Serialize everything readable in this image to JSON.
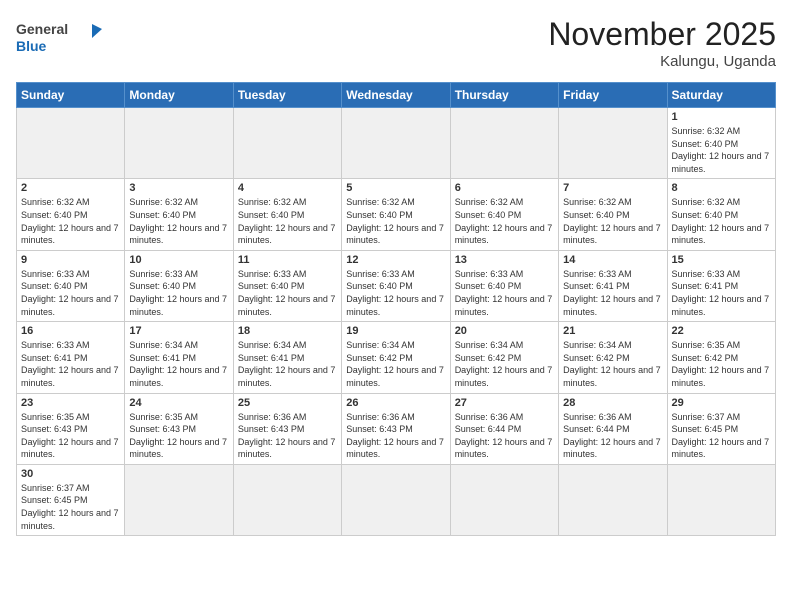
{
  "logo": {
    "text_general": "General",
    "text_blue": "Blue"
  },
  "title": {
    "month_year": "November 2025",
    "location": "Kalungu, Uganda"
  },
  "weekdays": [
    "Sunday",
    "Monday",
    "Tuesday",
    "Wednesday",
    "Thursday",
    "Friday",
    "Saturday"
  ],
  "weeks": [
    [
      {
        "day": "",
        "empty": true
      },
      {
        "day": "",
        "empty": true
      },
      {
        "day": "",
        "empty": true
      },
      {
        "day": "",
        "empty": true
      },
      {
        "day": "",
        "empty": true
      },
      {
        "day": "",
        "empty": true
      },
      {
        "day": "1",
        "sunrise": "6:32 AM",
        "sunset": "6:40 PM",
        "daylight": "12 hours and 7 minutes."
      }
    ],
    [
      {
        "day": "2",
        "sunrise": "6:32 AM",
        "sunset": "6:40 PM",
        "daylight": "12 hours and 7 minutes."
      },
      {
        "day": "3",
        "sunrise": "6:32 AM",
        "sunset": "6:40 PM",
        "daylight": "12 hours and 7 minutes."
      },
      {
        "day": "4",
        "sunrise": "6:32 AM",
        "sunset": "6:40 PM",
        "daylight": "12 hours and 7 minutes."
      },
      {
        "day": "5",
        "sunrise": "6:32 AM",
        "sunset": "6:40 PM",
        "daylight": "12 hours and 7 minutes."
      },
      {
        "day": "6",
        "sunrise": "6:32 AM",
        "sunset": "6:40 PM",
        "daylight": "12 hours and 7 minutes."
      },
      {
        "day": "7",
        "sunrise": "6:32 AM",
        "sunset": "6:40 PM",
        "daylight": "12 hours and 7 minutes."
      },
      {
        "day": "8",
        "sunrise": "6:32 AM",
        "sunset": "6:40 PM",
        "daylight": "12 hours and 7 minutes."
      }
    ],
    [
      {
        "day": "9",
        "sunrise": "6:33 AM",
        "sunset": "6:40 PM",
        "daylight": "12 hours and 7 minutes."
      },
      {
        "day": "10",
        "sunrise": "6:33 AM",
        "sunset": "6:40 PM",
        "daylight": "12 hours and 7 minutes."
      },
      {
        "day": "11",
        "sunrise": "6:33 AM",
        "sunset": "6:40 PM",
        "daylight": "12 hours and 7 minutes."
      },
      {
        "day": "12",
        "sunrise": "6:33 AM",
        "sunset": "6:40 PM",
        "daylight": "12 hours and 7 minutes."
      },
      {
        "day": "13",
        "sunrise": "6:33 AM",
        "sunset": "6:40 PM",
        "daylight": "12 hours and 7 minutes."
      },
      {
        "day": "14",
        "sunrise": "6:33 AM",
        "sunset": "6:41 PM",
        "daylight": "12 hours and 7 minutes."
      },
      {
        "day": "15",
        "sunrise": "6:33 AM",
        "sunset": "6:41 PM",
        "daylight": "12 hours and 7 minutes."
      }
    ],
    [
      {
        "day": "16",
        "sunrise": "6:33 AM",
        "sunset": "6:41 PM",
        "daylight": "12 hours and 7 minutes."
      },
      {
        "day": "17",
        "sunrise": "6:34 AM",
        "sunset": "6:41 PM",
        "daylight": "12 hours and 7 minutes."
      },
      {
        "day": "18",
        "sunrise": "6:34 AM",
        "sunset": "6:41 PM",
        "daylight": "12 hours and 7 minutes."
      },
      {
        "day": "19",
        "sunrise": "6:34 AM",
        "sunset": "6:42 PM",
        "daylight": "12 hours and 7 minutes."
      },
      {
        "day": "20",
        "sunrise": "6:34 AM",
        "sunset": "6:42 PM",
        "daylight": "12 hours and 7 minutes."
      },
      {
        "day": "21",
        "sunrise": "6:34 AM",
        "sunset": "6:42 PM",
        "daylight": "12 hours and 7 minutes."
      },
      {
        "day": "22",
        "sunrise": "6:35 AM",
        "sunset": "6:42 PM",
        "daylight": "12 hours and 7 minutes."
      }
    ],
    [
      {
        "day": "23",
        "sunrise": "6:35 AM",
        "sunset": "6:43 PM",
        "daylight": "12 hours and 7 minutes."
      },
      {
        "day": "24",
        "sunrise": "6:35 AM",
        "sunset": "6:43 PM",
        "daylight": "12 hours and 7 minutes."
      },
      {
        "day": "25",
        "sunrise": "6:36 AM",
        "sunset": "6:43 PM",
        "daylight": "12 hours and 7 minutes."
      },
      {
        "day": "26",
        "sunrise": "6:36 AM",
        "sunset": "6:43 PM",
        "daylight": "12 hours and 7 minutes."
      },
      {
        "day": "27",
        "sunrise": "6:36 AM",
        "sunset": "6:44 PM",
        "daylight": "12 hours and 7 minutes."
      },
      {
        "day": "28",
        "sunrise": "6:36 AM",
        "sunset": "6:44 PM",
        "daylight": "12 hours and 7 minutes."
      },
      {
        "day": "29",
        "sunrise": "6:37 AM",
        "sunset": "6:45 PM",
        "daylight": "12 hours and 7 minutes."
      }
    ],
    [
      {
        "day": "30",
        "sunrise": "6:37 AM",
        "sunset": "6:45 PM",
        "daylight": "12 hours and 7 minutes."
      },
      {
        "day": "",
        "empty": true
      },
      {
        "day": "",
        "empty": true
      },
      {
        "day": "",
        "empty": true
      },
      {
        "day": "",
        "empty": true
      },
      {
        "day": "",
        "empty": true
      },
      {
        "day": "",
        "empty": true
      }
    ]
  ]
}
